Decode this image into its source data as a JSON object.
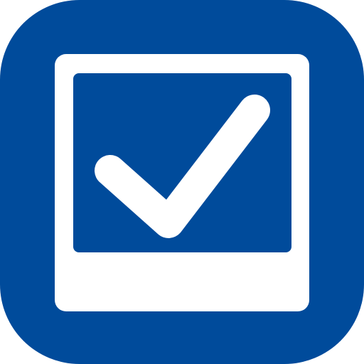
{
  "app_icon": {
    "name": "checked-photo-frame-app-icon",
    "icon": "check-mark-icon",
    "colors": {
      "background": "#004b9b",
      "foreground": "#ffffff"
    }
  }
}
